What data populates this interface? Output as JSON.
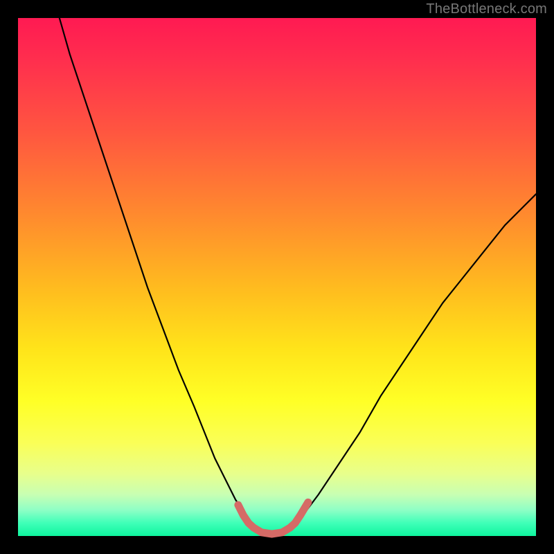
{
  "watermark": "TheBottleneck.com",
  "colors": {
    "background": "#000000",
    "curve_main": "#000000",
    "curve_highlight": "#d56a66"
  },
  "chart_data": {
    "type": "line",
    "title": "",
    "xlabel": "",
    "ylabel": "",
    "xlim": [
      0,
      100
    ],
    "ylim": [
      0,
      100
    ],
    "grid": false,
    "legend": false,
    "series": [
      {
        "name": "left-branch",
        "x": [
          8,
          10,
          13,
          16,
          19,
          22,
          25,
          28,
          31,
          34,
          36,
          38,
          40,
          42,
          44,
          45
        ],
        "values": [
          100,
          93,
          84,
          75,
          66,
          57,
          48,
          40,
          32,
          25,
          20,
          15,
          11,
          7,
          4,
          2
        ]
      },
      {
        "name": "right-branch",
        "x": [
          53,
          55,
          58,
          62,
          66,
          70,
          74,
          78,
          82,
          86,
          90,
          94,
          98,
          100
        ],
        "values": [
          2,
          4,
          8,
          14,
          20,
          27,
          33,
          39,
          45,
          50,
          55,
          60,
          64,
          66
        ]
      },
      {
        "name": "valley-floor",
        "x": [
          45,
          47,
          49,
          51,
          53
        ],
        "values": [
          2,
          0.7,
          0.4,
          0.7,
          2
        ]
      },
      {
        "name": "highlight-left",
        "x": [
          42.5,
          43.5,
          44.5,
          45.5
        ],
        "values": [
          6,
          4,
          2.5,
          1.6
        ]
      },
      {
        "name": "highlight-floor",
        "x": [
          45.5,
          47,
          49,
          51,
          52.5
        ],
        "values": [
          1.6,
          0.7,
          0.4,
          0.7,
          1.6
        ]
      },
      {
        "name": "highlight-right",
        "x": [
          52.5,
          53.5,
          54.5,
          56
        ],
        "values": [
          1.6,
          2.5,
          4,
          6.5
        ]
      }
    ]
  }
}
